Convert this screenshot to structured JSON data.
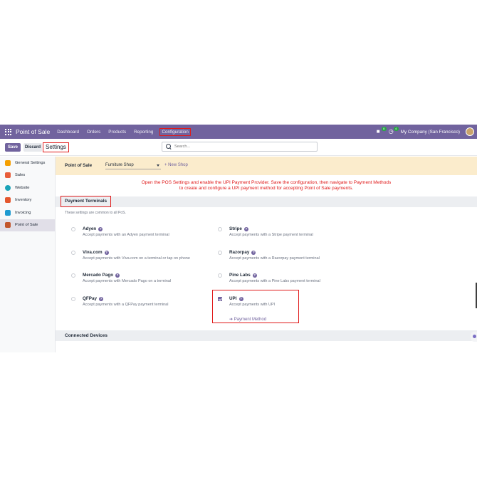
{
  "navbar": {
    "app_title": "Point of Sale",
    "menu": [
      "Dashboard",
      "Orders",
      "Products",
      "Reporting",
      "Configuration"
    ],
    "messages_count": "8",
    "activities_count": "4",
    "company": "My Company (San Francisco)"
  },
  "control": {
    "save_label": "Save",
    "discard_label": "Discard",
    "breadcrumb": "Settings",
    "search_placeholder": "Search..."
  },
  "sidebar": {
    "items": [
      {
        "label": "General Settings",
        "color": "#f59f00"
      },
      {
        "label": "Sales",
        "color": "#e85d3a"
      },
      {
        "label": "Website",
        "color": "#1aa3b8"
      },
      {
        "label": "Inventory",
        "color": "#e4572e"
      },
      {
        "label": "Invoicing",
        "color": "#1f9bd1"
      },
      {
        "label": "Point of Sale",
        "color": "#c2562c"
      }
    ]
  },
  "pos_banner": {
    "label": "Point of Sale",
    "shop": "Furniture Shop",
    "new_shop": "+ New Shop"
  },
  "instruction": {
    "line1": "Open the POS Settings and enable the UPI Payment Provider. Save the configuration, then navigate to Payment Methods",
    "line2": "to create and configure a UPI payment method for accepting Point of Sale payments."
  },
  "payment_terminals": {
    "title": "Payment Terminals",
    "description": "These settings are common to all PoS.",
    "settings": [
      {
        "title": "Adyen",
        "desc": "Accept payments with an Adyen payment terminal",
        "checked": false
      },
      {
        "title": "Stripe",
        "desc": "Accept payments with a Stripe payment terminal",
        "checked": false
      },
      {
        "title": "Viva.com",
        "desc": "Accept payments with Viva.com on a terminal or tap on phone",
        "checked": false
      },
      {
        "title": "Razorpay",
        "desc": "Accept payments with a Razorpay payment terminal",
        "checked": false
      },
      {
        "title": "Mercado Pago",
        "desc": "Accept payments with Mercado Pago on a terminal",
        "checked": false
      },
      {
        "title": "Pine Labs",
        "desc": "Accept payments with a Pine Labs payment terminal",
        "checked": false
      },
      {
        "title": "QFPay",
        "desc": "Accept payments with a QFPay payment terminal",
        "checked": false
      },
      {
        "title": "UPI",
        "desc": "Accept payments with UPI",
        "checked": true,
        "link": "➔ Payment Method"
      }
    ]
  },
  "connected_devices": {
    "title": "Connected Devices"
  },
  "colors": {
    "navbar": "#71639e",
    "accent": "#71639e",
    "highlight": "#e01a1a",
    "banner": "#fbeccc"
  }
}
